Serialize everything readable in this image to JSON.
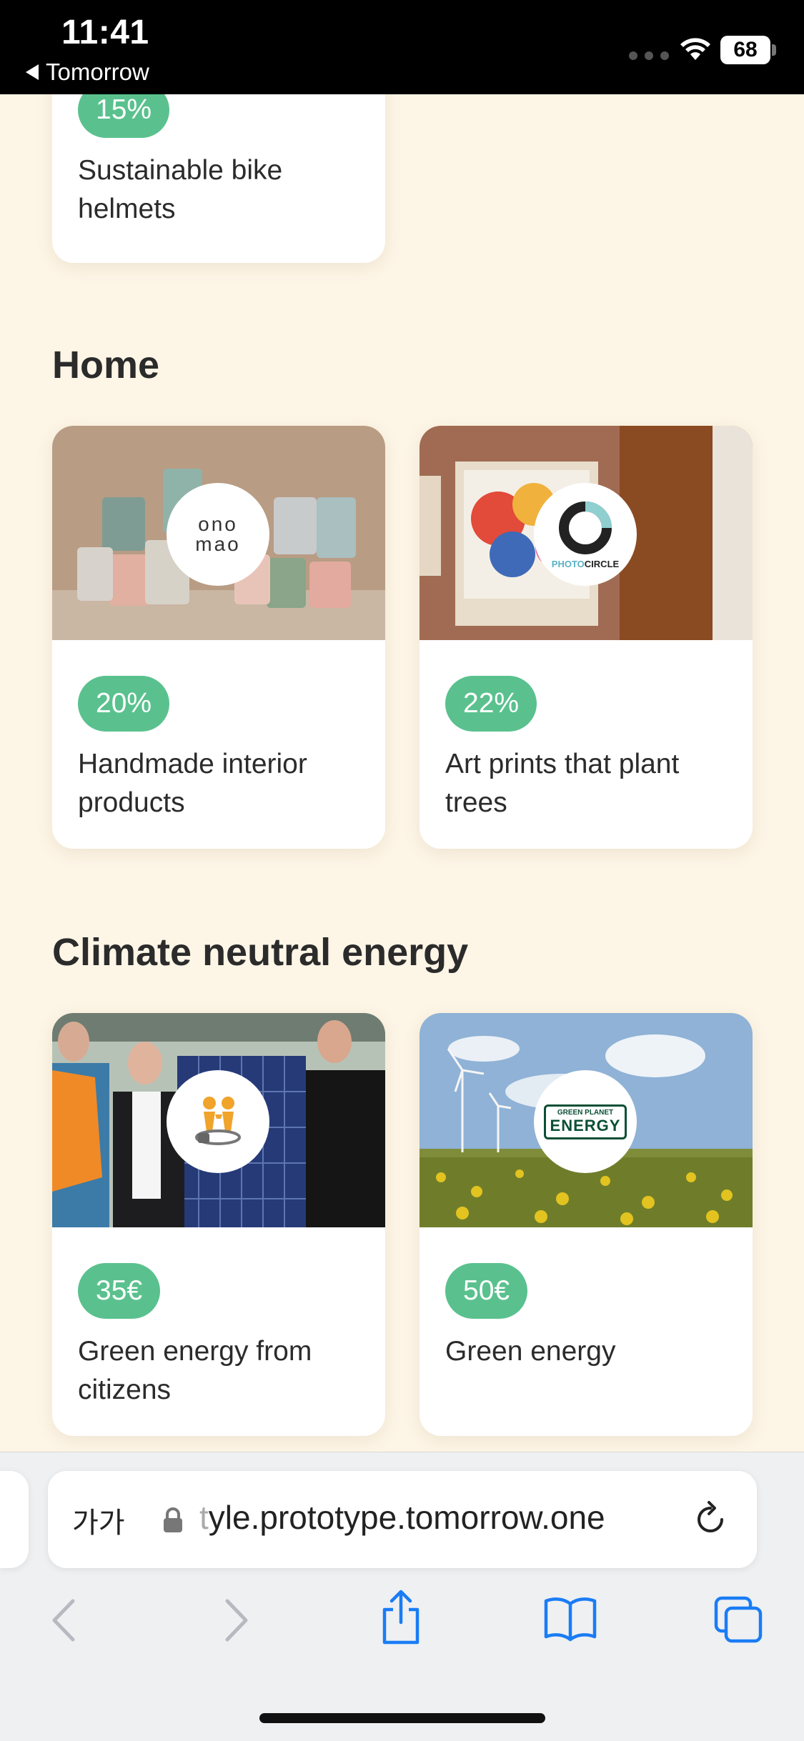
{
  "status": {
    "time": "11:41",
    "back_app": "Tomorrow",
    "battery": "68"
  },
  "cards": {
    "bike": {
      "badge": "15%",
      "title": "Sustainable bike helmets"
    },
    "onomao": {
      "badge": "20%",
      "title": "Handmade interior products",
      "logo_line1": "ono",
      "logo_line2": "mao"
    },
    "photocircle": {
      "badge": "22%",
      "title": "Art prints that plant trees",
      "logo_a": "PHOTO",
      "logo_b": "CIRCLE"
    },
    "citizens": {
      "badge": "35€",
      "title": "Green energy from citizens"
    },
    "greenplanet": {
      "badge": "50€",
      "title": "Green energy",
      "logo_a": "GREEN PLANET",
      "logo_b": "ENERGY"
    }
  },
  "sections": {
    "home": "Home",
    "energy": "Climate neutral energy"
  },
  "safari": {
    "aa_label": "가가",
    "url_faded": "t",
    "url": "yle.prototype.tomorrow.one"
  },
  "colors": {
    "badge": "#5ac18e",
    "background": "#fdf5e6",
    "ios_blue": "#1a7cf5"
  }
}
